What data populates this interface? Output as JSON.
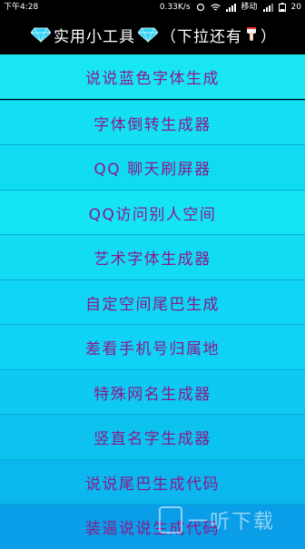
{
  "status": {
    "time": "下午4:28",
    "speed": "0.33K/s",
    "carrier": "移动",
    "battery": "20"
  },
  "header": {
    "title": "实用小工具",
    "hint": "（下拉还有",
    "hint_end": "）",
    "colors": {
      "gem": "#2fd0f5",
      "text": "#ffffff"
    }
  },
  "menu": {
    "items": [
      {
        "label": "说说蓝色字体生成",
        "bg": "#18e7f2"
      },
      {
        "label": "字体倒转生成器",
        "bg": "#13e0f3"
      },
      {
        "label": "QQ  聊天刷屏器",
        "bg": "#0fdcf3"
      },
      {
        "label": "QQ访问别人空间",
        "bg": "#14e5f5"
      },
      {
        "label": "艺术字体生成器",
        "bg": "#12dcf3"
      },
      {
        "label": "自定空间尾巴生成",
        "bg": "#0fd6f4"
      },
      {
        "label": "差看手机号归属地",
        "bg": "#10d2f4"
      },
      {
        "label": "特殊网名生成器",
        "bg": "#0ec9f1"
      },
      {
        "label": "竖直名字生成器",
        "bg": "#0cc2ef"
      },
      {
        "label": "说说尾巴生成代码",
        "bg": "#0bb7ef"
      },
      {
        "label": "装逼说说生成代码",
        "bg": "#0a9ee8"
      }
    ],
    "text_color": "#8b1a8b"
  },
  "watermark": {
    "text": "一听下载"
  }
}
